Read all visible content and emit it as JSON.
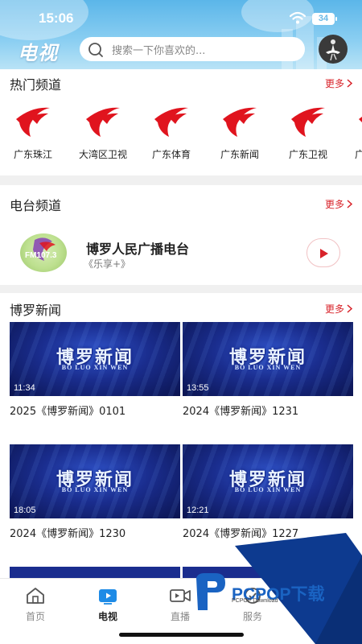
{
  "status": {
    "time": "15:06",
    "battery": "34"
  },
  "header": {
    "brand": "电视",
    "search_placeholder": "搜索一下你喜欢的..."
  },
  "hot_channels": {
    "title": "热门频道",
    "more": "更多",
    "items": [
      {
        "name": "广东珠江",
        "icon": "gdtv-logo-icon"
      },
      {
        "name": "大湾区卫视",
        "icon": "gdtv-logo-icon"
      },
      {
        "name": "广东体育",
        "icon": "gdtv-logo-icon"
      },
      {
        "name": "广东新闻",
        "icon": "gdtv-logo-icon"
      },
      {
        "name": "广东卫视",
        "icon": "gdtv-logo-icon"
      },
      {
        "name": "广",
        "icon": "gdtv-logo-icon"
      }
    ]
  },
  "radio": {
    "title": "电台频道",
    "more": "更多",
    "station": {
      "logo_text": "FM107.3",
      "name": "博罗人民广播电台",
      "subtitle": "《乐享+》"
    }
  },
  "news": {
    "title": "博罗新闻",
    "more": "更多",
    "thumb_title": "博罗新闻",
    "thumb_sub": "BO LUO XIN WEN",
    "videos": [
      {
        "duration": "11:34",
        "title": "2025《博罗新闻》0101"
      },
      {
        "duration": "13:55",
        "title": "2024《博罗新闻》1231"
      },
      {
        "duration": "18:05",
        "title": "2024《博罗新闻》1230"
      },
      {
        "duration": "12:21",
        "title": "2024《博罗新闻》1227"
      }
    ]
  },
  "tabbar": {
    "items": [
      {
        "label": "首页",
        "icon": "home-icon",
        "active": false
      },
      {
        "label": "电视",
        "icon": "tv-icon",
        "active": true
      },
      {
        "label": "直播",
        "icon": "live-camera-icon",
        "active": false
      },
      {
        "label": "服务",
        "icon": "service-icon",
        "active": false
      }
    ]
  },
  "watermark": {
    "text": "PCPOP下载",
    "sub": "PCPOP Download"
  },
  "colors": {
    "accent_red": "#d8232a",
    "header_blue": "#5bb6e9",
    "tab_active_blue": "#1e8be6",
    "watermark_blue": "#1a63c2"
  }
}
